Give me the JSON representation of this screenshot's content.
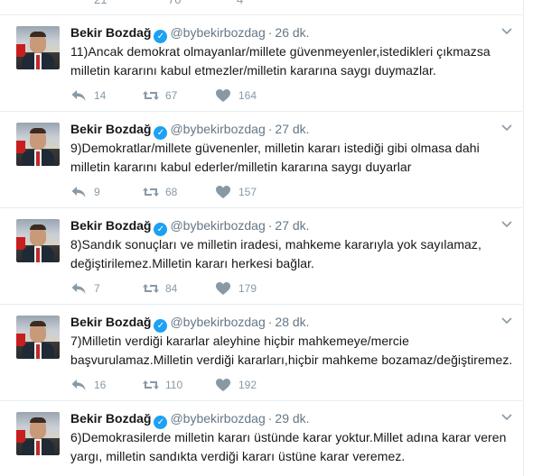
{
  "top_cut": {
    "counts": [
      "21",
      "70",
      "4"
    ]
  },
  "tweets": [
    {
      "name": "Bekir Bozdağ",
      "handle": "@bybekirbozdag",
      "time": "26 dk.",
      "text": "11)Ancak demokrat olmayanlar/millete güvenmeyenler,istedikleri çıkmazsa milletin kararını kabul etmezler/milletin kararına saygı duymazlar.",
      "replies": "14",
      "retweets": "67",
      "likes": "164"
    },
    {
      "name": "Bekir Bozdağ",
      "handle": "@bybekirbozdag",
      "time": "27 dk.",
      "text": "9)Demokratlar/millete güvenenler, milletin kararı istediği gibi olmasa dahi milletin kararını kabul ederler/milletin kararına saygı duyarlar",
      "replies": "9",
      "retweets": "68",
      "likes": "157"
    },
    {
      "name": "Bekir Bozdağ",
      "handle": "@bybekirbozdag",
      "time": "27 dk.",
      "text": "8)Sandık sonuçları ve milletin iradesi, mahkeme kararıyla yok sayılamaz, değiştirilemez.Milletin kararı herkesi bağlar.",
      "replies": "7",
      "retweets": "84",
      "likes": "179"
    },
    {
      "name": "Bekir Bozdağ",
      "handle": "@bybekirbozdag",
      "time": "28 dk.",
      "text": "7)Milletin verdiği kararlar aleyhine hiçbir mahkemeye/mercie başvurulamaz.Milletin verdiği kararları,hiçbir mahkeme bozamaz/değiştiremez.",
      "replies": "16",
      "retweets": "110",
      "likes": "192"
    },
    {
      "name": "Bekir Bozdağ",
      "handle": "@bybekirbozdag",
      "time": "29 dk.",
      "text": "6)Demokrasilerde milletin kararı üstünde karar yoktur.Millet adına karar veren yargı, milletin sandıkta verdiği kararı üstüne karar veremez.",
      "replies": "",
      "retweets": "",
      "likes": ""
    }
  ],
  "colors": {
    "verified": "#1da1f2",
    "muted": "#8899a6",
    "text": "#14171a",
    "divider": "#e6ecf0"
  },
  "icons": [
    "verified-badge-icon",
    "chevron-down-icon",
    "reply-icon",
    "retweet-icon",
    "like-icon"
  ]
}
